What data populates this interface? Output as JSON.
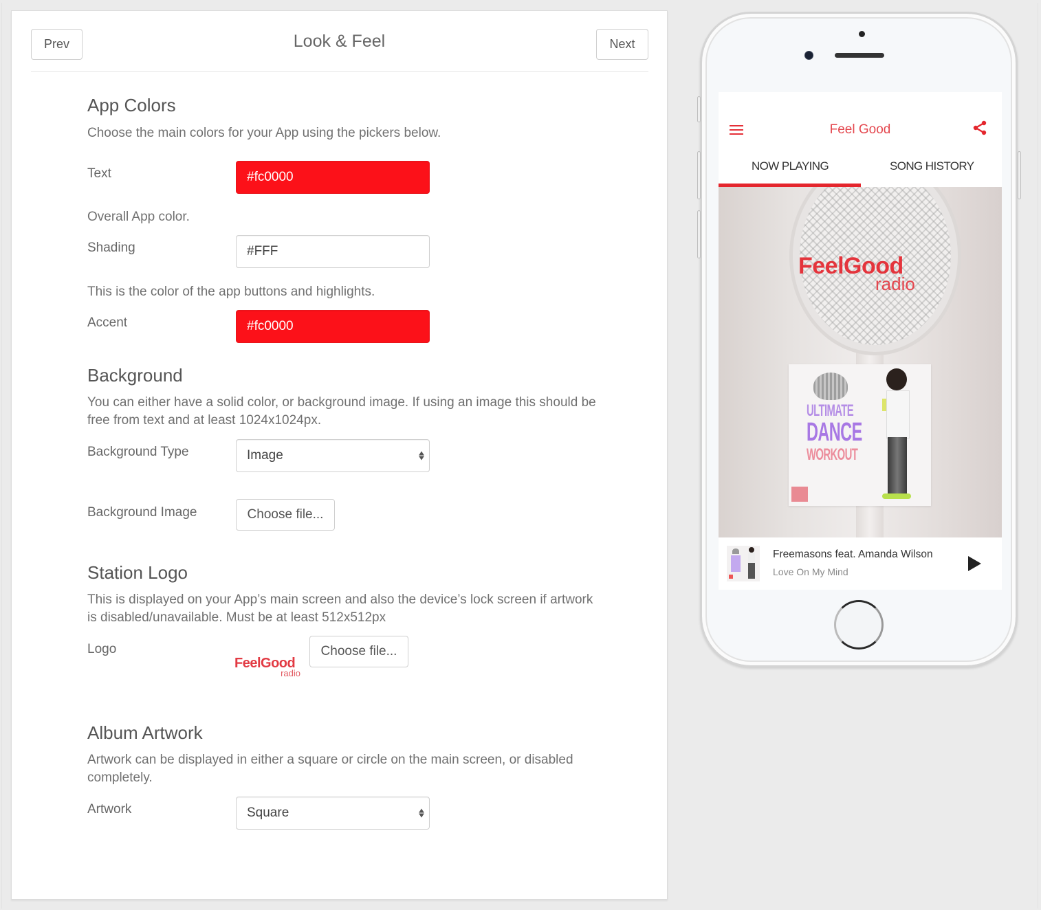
{
  "header": {
    "title": "Look & Feel",
    "prev_label": "Prev",
    "next_label": "Next"
  },
  "sections": {
    "app_colors": {
      "heading": "App Colors",
      "description": "Choose the main colors for your App using the pickers below.",
      "text_label": "Text",
      "text_value": "#fc0000",
      "shading_help": "Overall App color.",
      "shading_label": "Shading",
      "shading_value": "#FFF",
      "accent_help": "This is the color of the app buttons and highlights.",
      "accent_label": "Accent",
      "accent_value": "#fc0000"
    },
    "background": {
      "heading": "Background",
      "description": "You can either have a solid color, or background image. If using an image this should be free from text and at least 1024x1024px.",
      "type_label": "Background Type",
      "type_value": "Image",
      "image_label": "Background Image",
      "choose_file_label": "Choose file..."
    },
    "station_logo": {
      "heading": "Station Logo",
      "description": "This is displayed on your App’s main screen and also the device’s lock screen if artwork is disabled/unavailable. Must be at least 512x512px",
      "logo_label": "Logo",
      "logo_preview_main": "FeelGood",
      "logo_preview_sub": "radio",
      "choose_file_label": "Choose file..."
    },
    "album_artwork": {
      "heading": "Album Artwork",
      "description": "Artwork can be displayed in either a square or circle on the main screen, or disabled completely.",
      "artwork_label": "Artwork",
      "artwork_value": "Square"
    }
  },
  "colors": {
    "accent": "#fc0000",
    "shading": "#FFFFFF"
  },
  "phone_preview": {
    "app_title": "Feel Good",
    "menu_icon": "hamburger-icon",
    "share_icon": "share-icon",
    "tabs": [
      {
        "label": "NOW PLAYING",
        "active": true
      },
      {
        "label": "SONG HISTORY",
        "active": false
      }
    ],
    "hero_logo_main": "FeelGood",
    "hero_logo_sub": "radio",
    "album_art_lines": [
      "ULTIMATE",
      "DANCE",
      "WORKOUT"
    ],
    "now_playing": {
      "artist": "Freemasons feat. Amanda Wilson",
      "title": "Love On My Mind",
      "play_icon": "play-icon"
    }
  }
}
